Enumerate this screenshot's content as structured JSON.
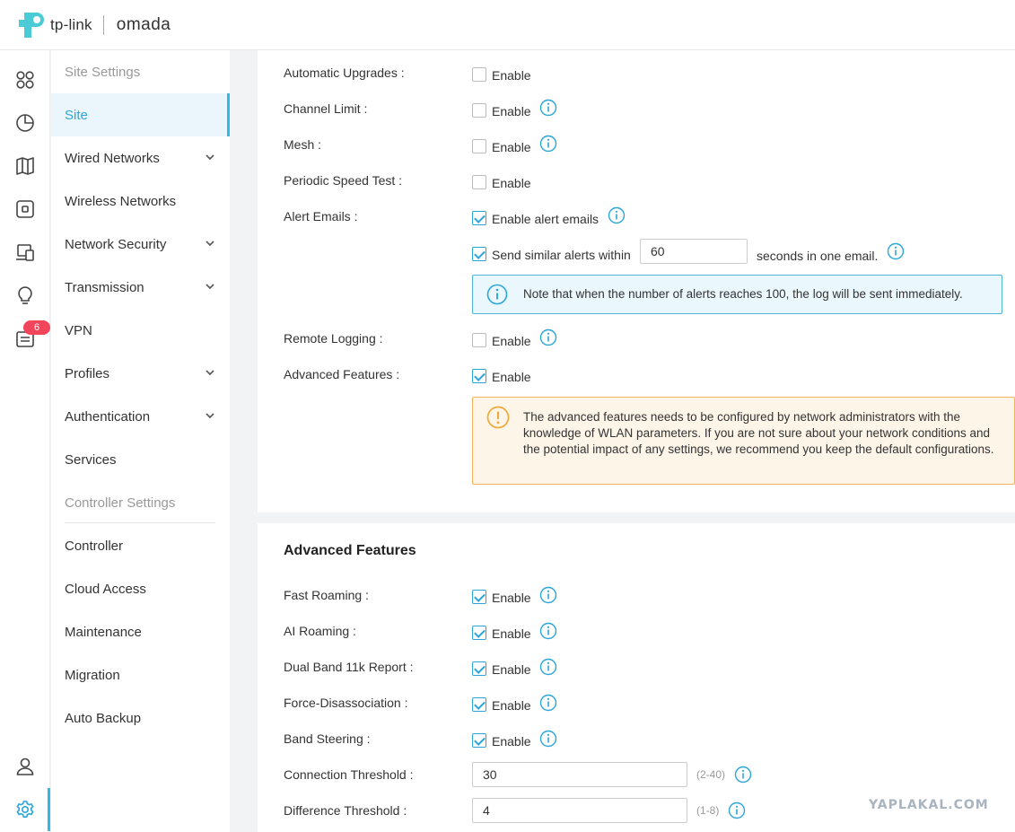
{
  "brand": {
    "logo_text": "tp-link",
    "product": "omada"
  },
  "rail": {
    "badge_count": "6"
  },
  "subnav": {
    "items": [
      {
        "label": "Site Settings"
      },
      {
        "label": "Site"
      },
      {
        "label": "Wired Networks"
      },
      {
        "label": "Wireless Networks"
      },
      {
        "label": "Network Security"
      },
      {
        "label": "Transmission"
      },
      {
        "label": "VPN"
      },
      {
        "label": "Profiles"
      },
      {
        "label": "Authentication"
      },
      {
        "label": "Services"
      },
      {
        "label": "Controller Settings"
      },
      {
        "label": "Controller"
      },
      {
        "label": "Cloud Access"
      },
      {
        "label": "Maintenance"
      },
      {
        "label": "Migration"
      },
      {
        "label": "Auto Backup"
      }
    ]
  },
  "general": {
    "automatic_upgrades": {
      "label": "Automatic Upgrades :",
      "option": "Enable",
      "checked": false
    },
    "channel_limit": {
      "label": "Channel Limit :",
      "option": "Enable",
      "checked": false
    },
    "mesh": {
      "label": "Mesh :",
      "option": "Enable",
      "checked": false
    },
    "periodic_speed_test": {
      "label": "Periodic Speed Test :",
      "option": "Enable",
      "checked": false
    },
    "alert_emails": {
      "label": "Alert Emails :",
      "option": "Enable alert emails",
      "checked": true,
      "similar_label": "Send similar alerts within",
      "similar_value": "60",
      "similar_suffix": "seconds in one email.",
      "note": "Note that when the number of alerts reaches 100, the log will be sent immediately."
    },
    "remote_logging": {
      "label": "Remote Logging :",
      "option": "Enable",
      "checked": false
    },
    "advanced_features": {
      "label": "Advanced Features :",
      "option": "Enable",
      "checked": true,
      "warning": "The advanced features needs to be configured by network administrators with the knowledge of WLAN parameters. If you are not sure about your network conditions and the potential impact of any settings, we recommend you keep the default configurations."
    }
  },
  "advanced": {
    "title": "Advanced Features",
    "fast_roaming": {
      "label": "Fast Roaming :",
      "option": "Enable",
      "checked": true
    },
    "ai_roaming": {
      "label": "AI Roaming :",
      "option": "Enable",
      "checked": true
    },
    "dual_band_11k": {
      "label": "Dual Band 11k Report :",
      "option": "Enable",
      "checked": true
    },
    "force_disassociation": {
      "label": "Force-Disassociation :",
      "option": "Enable",
      "checked": true
    },
    "band_steering": {
      "label": "Band Steering :",
      "option": "Enable",
      "checked": true
    },
    "connection_threshold": {
      "label": "Connection Threshold :",
      "value": "30",
      "range": "(2-40)"
    },
    "difference_threshold": {
      "label": "Difference Threshold :",
      "value": "4",
      "range": "(1-8)"
    }
  },
  "watermark": "YAPLAKAL.COM",
  "colors": {
    "accent": "#2bbbe6",
    "link_blue": "#2ba6d9",
    "badge_red": "#f0455a",
    "warning": "#f3b35a"
  }
}
